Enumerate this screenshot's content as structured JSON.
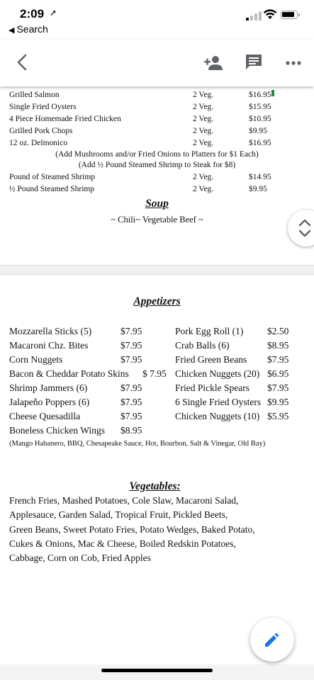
{
  "status": {
    "time": "2:09",
    "back_app": "Search"
  },
  "toolbar": {
    "back": "back-arrow",
    "add_user": "add-person-icon",
    "comment": "comment-icon",
    "more": "more-icon"
  },
  "entrees": [
    {
      "name": "Grilled Salmon",
      "veg": "2 Veg.",
      "price": "$16.95"
    },
    {
      "name": "Single Fried Oysters",
      "veg": "2 Veg.",
      "price": "$15.95"
    },
    {
      "name": "4 Piece Homemade Fried Chicken",
      "veg": "2 Veg.",
      "price": "$10.95"
    },
    {
      "name": "Grilled Pork Chops",
      "veg": "2 Veg.",
      "price": "$9.95"
    },
    {
      "name": "12 oz. Delmonico",
      "veg": "2 Veg.",
      "price": "$16.95"
    }
  ],
  "entree_notes": [
    "(Add Mushrooms and/or Fried Onions to Platters for $1 Each)",
    "(Add ½ Pound Steamed Shrimp to Steak for $8)"
  ],
  "shrimp": [
    {
      "name": "Pound of Steamed Shrimp",
      "veg": "2 Veg.",
      "price": "$14.95"
    },
    {
      "name": "½ Pound Steamed Shrimp",
      "veg": "2 Veg.",
      "price": "$9.95"
    }
  ],
  "soup": {
    "heading": "Soup",
    "items": "~ Chili~ Vegetable Beef ~"
  },
  "appetizers": {
    "heading": "Appetizers",
    "left": [
      {
        "name": "Mozzarella Sticks (5)",
        "price": "$7.95"
      },
      {
        "name": "Macaroni Chz. Bites",
        "price": "$7.95"
      },
      {
        "name": "Corn Nuggets",
        "price": "$7.95"
      },
      {
        "name": "Bacon & Cheddar Potato Skins",
        "price": "$ 7.95"
      },
      {
        "name": "Shrimp Jammers (6)",
        "price": "$7.95"
      },
      {
        "name": "Jalapeño Poppers (6)",
        "price": "$7.95"
      },
      {
        "name": "Cheese Quesadilla",
        "price": "$7.95"
      },
      {
        "name": "Boneless Chicken Wings",
        "price": "$8.95"
      }
    ],
    "right": [
      {
        "name": "Pork Egg Roll (1)",
        "price": "$2.50"
      },
      {
        "name": "Crab Balls (6)",
        "price": "$8.95"
      },
      {
        "name": "Fried Green Beans",
        "price": "$7.95"
      },
      {
        "name": "Chicken Nuggets (20)",
        "price": "$6.95"
      },
      {
        "name": "Fried Pickle Spears",
        "price": "$7.95"
      },
      {
        "name": "6 Single Fried Oysters",
        "price": "$9.95"
      },
      {
        "name": "Chicken Nuggets (10)",
        "price": "$5.95"
      }
    ],
    "sauces": "(Mango Habanero, BBQ, Chesapeake Sauce, Hot, Bourbon, Salt & Vinegar, Old Bay)"
  },
  "vegetables": {
    "heading": "Vegetables:",
    "lines": [
      "French Fries, Mashed Potatoes, Cole Slaw, Macaroni Salad,",
      "Applesauce, Garden Salad, Tropical Fruit, Pickled Beets,",
      "Green Beans, Sweet Potato Fries, Potato Wedges, Baked Potato,",
      "Cukes & Onions, Mac & Cheese, Boiled Redskin Potatoes,",
      "Cabbage, Corn on Cob, Fried Apples"
    ]
  },
  "fab": "edit-icon",
  "colors": {
    "accent_blue": "#1a73e8",
    "marker_green": "#1e8e3e"
  }
}
